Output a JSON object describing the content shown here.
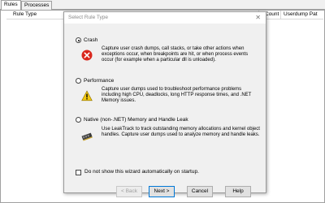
{
  "tabs": [
    {
      "label": "Rules"
    },
    {
      "label": "Processes"
    }
  ],
  "list_columns": [
    "Rule Type",
    "Count",
    "Userdump Pat"
  ],
  "dialog": {
    "title": "Select Rule Type",
    "close_symbol": "✕",
    "options": [
      {
        "label": "Crash",
        "selected": true,
        "icon": "error-icon",
        "description": "Capture user crash dumps, call stacks, or take other actions when exceptions occur, when breakpoints are hit, or when process events occur (for example when a particular dll is unloaded)."
      },
      {
        "label": "Performance",
        "selected": false,
        "icon": "warning-icon",
        "description": "Capture user dumps used to troubleshoot performance problems including high CPU, deadlocks, long HTTP response times, and .NET Memory issues."
      },
      {
        "label": "Native (non-.NET) Memory and Handle Leak",
        "selected": false,
        "icon": "memory-chip-icon",
        "description": "Use LeakTrack to track outstanding memory allocations and kernel object handles. Capture user dumps used to analyze memory and handle leaks."
      }
    ],
    "checkbox_label": "Do not show this wizard automatically on startup.",
    "checkbox_checked": false,
    "buttons": {
      "back": "< Back",
      "next": "Next >",
      "cancel": "Cancel",
      "help": "Help"
    }
  },
  "colors": {
    "dialog_bg": "#f0f0f0",
    "error_red": "#d9261c",
    "warning_yellow": "#f2c811",
    "accent_blue": "#0078d7"
  }
}
